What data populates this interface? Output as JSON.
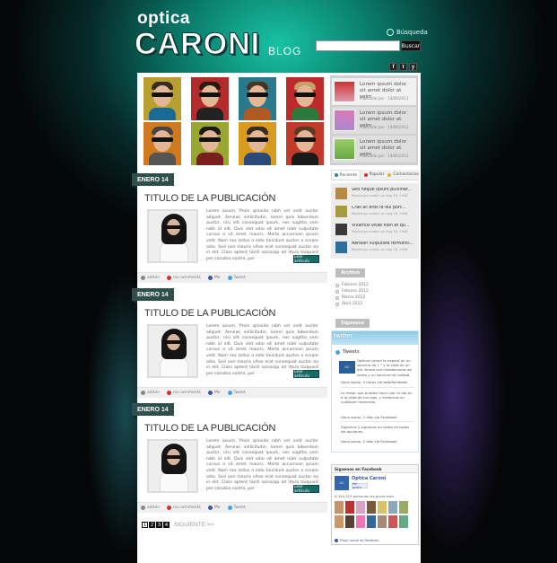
{
  "brand": {
    "top": "optica",
    "main": "CARONI",
    "suffix": "BLOG"
  },
  "search": {
    "label": "Búsqueda",
    "placeholder": "",
    "button": "Buscar"
  },
  "social": [
    "f",
    "t",
    "y"
  ],
  "featured": [
    {
      "title": "Lorem ipsum dolor sit amet dolor at selm",
      "date": "Publicado por - 14/06/2013"
    },
    {
      "title": "Lorem ipsum dolor sit amet dolor at selm",
      "date": "Publicado por - 14/06/2013"
    },
    {
      "title": "Lorem ipsum dolor sit amet dolor at selm",
      "date": "Publicado por - 14/06/2013"
    }
  ],
  "posts": [
    {
      "date": "ENERO 14",
      "title": "TITULO DE LA PUBLICACIÓN",
      "body": "Lorem ipsum. Proin gravida nibh vel velit auctor aliquet. Aenean sollicitudin, lorem quis bibendum auctor, nisi elit consequat ipsum, nec sagittis sem nibh id elit. Duis sed odio sit amet nibh vulputate cursus a sit amet mauris. Morbi accumsan ipsum velit. Nam nec tellus a odio tincidunt auctor a ornare odio. Sed non mauris vitae erat consequat auctor eu in elit. Class aptent taciti sociosqu ad litora torquent per conubia nostra, per",
      "more": "Leer artículo",
      "author": "admin",
      "comments": "no comments",
      "like": "Me",
      "tweet": "Tweet"
    },
    {
      "date": "ENERO 14",
      "title": "TITULO DE LA PUBLICACIÓN",
      "body": "Lorem ipsum. Proin gravida nibh vel velit auctor aliquet. Aenean sollicitudin, lorem quis bibendum auctor, nisi elit consequat ipsum, nec sagittis sem nibh id elit. Duis sed odio sit amet nibh vulputate cursus a sit amet mauris. Morbi accumsan ipsum velit. Nam nec tellus a odio tincidunt auctor a ornare odio. Sed non mauris vitae erat consequat auctor eu in elit. Class aptent taciti sociosqu ad litora torquent per conubia nostra, per",
      "more": "Leer artículo",
      "author": "admin",
      "comments": "no comments",
      "like": "Me",
      "tweet": "Tweet"
    },
    {
      "date": "ENERO 14",
      "title": "TITULO DE LA PUBLICACIÓN",
      "body": "Lorem ipsum. Proin gravida nibh vel velit auctor aliquet. Aenean sollicitudin, lorem quis bibendum auctor, nisi elit consequat ipsum, nec sagittis sem nibh id elit. Duis sed odio sit amet nibh vulputate cursus a sit amet mauris. Morbi accumsan ipsum velit. Nam nec tellus a odio tincidunt auctor a ornare odio. Sed non mauris vitae erat consequat auctor eu in elit. Class aptent taciti sociosqu ad litora torquent per conubia nostra, per",
      "more": "Leer artículo",
      "author": "admin",
      "comments": "no comments",
      "like": "Me",
      "tweet": "Tweet"
    }
  ],
  "pagination": {
    "pages": [
      "1",
      "2",
      "3",
      "4"
    ],
    "current": "1",
    "next": "SIGUIENTE >>"
  },
  "sidebar": {
    "tabs": [
      "Reciente",
      "Popular",
      "Comentarios"
    ],
    "recent": [
      {
        "title": "Sed neque ipsum pulvinar...",
        "date": "Posted por admin on Aug 18, 2008"
      },
      {
        "title": "Cras ac eros id dui port...",
        "date": "Posted por admin on Aug 18, 2008"
      },
      {
        "title": "Vivamus vitae nibh et qu...",
        "date": "Posted por admin on Aug 18, 2008"
      },
      {
        "title": "Aenean vulputate fermenti...",
        "date": "Posted por admin on Aug 18, 2008"
      }
    ],
    "archive_title": "Archivo",
    "archive": [
      "Febrero 2012",
      "Febrero 2012",
      "Marzo 2012",
      "Abril 2012"
    ],
    "follow_title": "Síguenos",
    "twitter": {
      "logo": "twitter",
      "sub": "Tweets",
      "tweets": [
        {
          "text": "Ópticas caroni te espera en un servicio de 1 ° y la vista es un día. Ahora con instalaciones de venta y un servicio de calidad.",
          "time": "Hace aprox. 4 horas vía web/facebook"
        },
        {
          "text": "Lo mejor que puedes hacer por tu día es a la vista de tus ojos, y visitarnos en cualquier momento.",
          "time": "Hace aprox. 2 días vía Facebook"
        },
        {
          "text": "Somos los ópticas, te acompañamos.",
          "time": "Hace aprox. 2 días vía Facebook"
        },
        {
          "text": "Síguenos y síguenos en redes en todas las opciones.",
          "time": "Hace aprox. 2 días vía Facebook"
        }
      ]
    },
    "facebook": {
      "title": "Síguenos en Facebook",
      "page": "Optica Caroni",
      "like": "Me gusta",
      "count": "A 344,325 personas les gusta esto.",
      "plugin": "Plugin social de Facebook"
    }
  }
}
